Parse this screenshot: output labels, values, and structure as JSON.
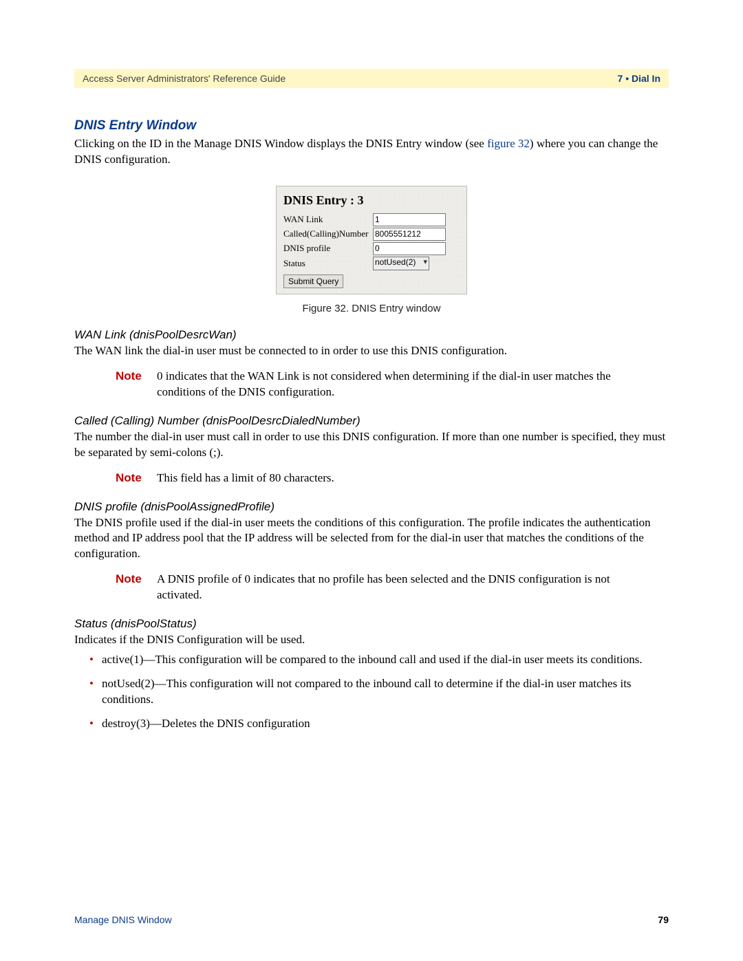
{
  "header": {
    "left": "Access Server Administrators' Reference Guide",
    "right": "7 • Dial In"
  },
  "section_title": "DNIS Entry Window",
  "intro_pre": "Clicking on the ID in the Manage DNIS Window displays the DNIS Entry window (see ",
  "intro_link": "figure 32",
  "intro_post": ") where you can change the DNIS configuration.",
  "figure": {
    "title": "DNIS Entry : 3",
    "rows": {
      "wan_link_label": "WAN Link",
      "wan_link_value": "1",
      "called_label": "Called(Calling)Number",
      "called_value": "8005551212",
      "profile_label": "DNIS profile",
      "profile_value": "0",
      "status_label": "Status",
      "status_value": "notUsed(2)"
    },
    "button": "Submit Query",
    "caption": "Figure 32. DNIS Entry window"
  },
  "wan": {
    "heading": "WAN Link (dnisPoolDesrcWan)",
    "body": "The WAN link the dial-in user must be connected to in order to use this DNIS configuration.",
    "note": "0 indicates that the WAN Link is not considered when determining if the dial-in user matches the conditions of the DNIS configuration."
  },
  "called": {
    "heading": "Called (Calling) Number (dnisPoolDesrcDialedNumber)",
    "body": "The number the dial-in user must call in order to use this DNIS configuration. If more than one number is specified, they must be separated by semi-colons (;).",
    "note": "This field has a limit of 80 characters."
  },
  "profile": {
    "heading": "DNIS profile (dnisPoolAssignedProfile)",
    "body": "The DNIS profile used if the dial-in user meets the conditions of this configuration. The profile indicates the authentication method and IP address pool that the IP address will be selected from for the dial-in user that matches the conditions of the configuration.",
    "note": "A DNIS profile of 0 indicates that no profile has been selected and the DNIS configuration is not activated."
  },
  "status": {
    "heading": "Status (dnisPoolStatus)",
    "body": "Indicates if the DNIS Configuration will be used.",
    "items": [
      "active(1)—This configuration will be compared to the inbound call and used if the dial-in user meets its conditions.",
      "notUsed(2)—This configuration will not compared to the inbound call to determine if the dial-in user matches its conditions.",
      "destroy(3)—Deletes the DNIS configuration"
    ]
  },
  "note_label": "Note",
  "footer": {
    "left": "Manage DNIS Window",
    "right": "79"
  }
}
